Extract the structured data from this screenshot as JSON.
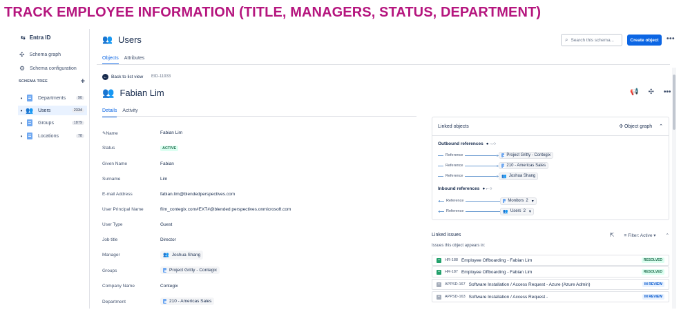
{
  "banner": "TRACK EMPLOYEE INFORMATION (TITLE, MANAGERS, STATUS, DEPARTMENT)",
  "sidebar": {
    "app_name": "Entra ID",
    "links": [
      {
        "label": "Schema graph",
        "icon": "graph-icon"
      },
      {
        "label": "Schema configuration",
        "icon": "gear-icon"
      }
    ],
    "tree_title": "SCHEMA TREE",
    "items": [
      {
        "label": "Departments",
        "count": "90",
        "icon": "doc-icon"
      },
      {
        "label": "Users",
        "count": "2334",
        "icon": "people-icon",
        "active": true
      },
      {
        "label": "Groups",
        "count": "1879",
        "icon": "doc-icon"
      },
      {
        "label": "Locations",
        "count": "78",
        "icon": "doc-icon"
      }
    ]
  },
  "header": {
    "title": "Users",
    "search_placeholder": "Search this schema...",
    "create_label": "Create object",
    "tabs": [
      "Objects",
      "Attributes"
    ]
  },
  "object": {
    "back_label": "Back to list view",
    "id": "EID-11933",
    "name": "Fabian Lim",
    "tabs": [
      "Details",
      "Activity"
    ],
    "fields": {
      "name": {
        "label": "Name",
        "value": "Fabian Lim"
      },
      "status": {
        "label": "Status",
        "value": "ACTIVE"
      },
      "given_name": {
        "label": "Given Name",
        "value": "Fabian"
      },
      "surname": {
        "label": "Surname",
        "value": "Lim"
      },
      "email": {
        "label": "E-mail Address",
        "value": "fabian.lim@blendedperspectives.com"
      },
      "upn": {
        "label": "User Principal Name",
        "value": "flim_contegix.com#EXT#@blended perspectives.onmicrosoft.com"
      },
      "user_type": {
        "label": "User Type",
        "value": "Guest"
      },
      "job_title": {
        "label": "Job title",
        "value": "Director"
      },
      "manager": {
        "label": "Manager",
        "value": "Joshua Shang"
      },
      "groups": {
        "label": "Groups",
        "value": "Project Gritty - Contegix"
      },
      "company": {
        "label": "Company Name",
        "value": "Contegix"
      },
      "department": {
        "label": "Department",
        "value": "210 - Americas Sales"
      }
    }
  },
  "linked_objects": {
    "title": "Linked objects",
    "graph_label": "Object graph",
    "outbound_title": "Outbound references",
    "inbound_title": "Inbound references",
    "ref_label": "Reference",
    "outbound": [
      "Project Gritty - Contegix",
      "210 - Americas Sales",
      "Joshua Shang"
    ],
    "inbound": [
      {
        "label": "Monitors",
        "count": "2"
      },
      {
        "label": "Users",
        "count": "2"
      }
    ]
  },
  "linked_issues": {
    "title": "Linked issues",
    "filter_label": "Filter: Active",
    "subtitle": "Issues this object appears in:",
    "issues": [
      {
        "key": "HR-188",
        "summary": "Employee Offboarding - Fabian Lim",
        "status": "RESOLVED"
      },
      {
        "key": "HR-187",
        "summary": "Employee Offboarding - Fabian Lim",
        "status": "RESOLVED"
      },
      {
        "key": "APPSD-167",
        "summary": "Software Installation / Access Request - Azure (Azure Admin)",
        "status": "IN REVIEW"
      },
      {
        "key": "APPSD-163",
        "summary": "Software Installation / Access Request -",
        "status": "IN REVIEW"
      }
    ]
  },
  "colors": {
    "banner": "#b5157e",
    "primary": "#0c66e4",
    "resolved": "#216e4e"
  }
}
